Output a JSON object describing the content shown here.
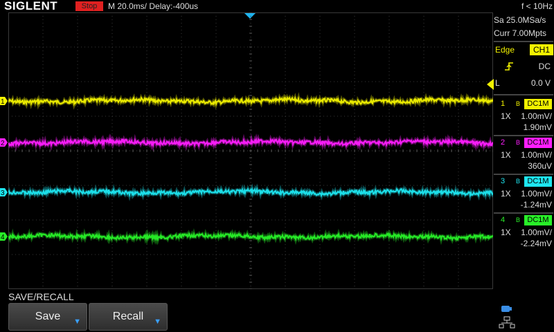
{
  "header": {
    "brand": "SIGLENT",
    "run_state": "Stop",
    "timebase": "M 20.0ms/ Delay:-400us",
    "frequency": "f < 10Hz"
  },
  "acquisition": {
    "sample_rate": "Sa 25.0MSa/s",
    "memory": "Curr 7.00Mpts"
  },
  "trigger": {
    "type_label": "Edge",
    "source": "CH1",
    "coupling": "DC",
    "level_label": "L",
    "level": "0.0 V"
  },
  "channels": [
    {
      "num": "1",
      "b": "B",
      "coupling": "DC1M",
      "probe": "1X",
      "scale": "1.00mV/",
      "offset": "1.90mV",
      "color": "#f2f200",
      "marker": "1",
      "level": 0.32
    },
    {
      "num": "2",
      "b": "B",
      "coupling": "DC1M",
      "probe": "1X",
      "scale": "1.00mV/",
      "offset": "360uV",
      "color": "#ff1eff",
      "marker": "2",
      "level": 0.47
    },
    {
      "num": "3",
      "b": "B",
      "coupling": "DC1M",
      "probe": "1X",
      "scale": "1.00mV/",
      "offset": "-1.24mV",
      "color": "#1ee6f0",
      "marker": "3",
      "level": 0.65
    },
    {
      "num": "4",
      "b": "B",
      "coupling": "DC1M",
      "probe": "1X",
      "scale": "1.00mV/",
      "offset": "-2.24mV",
      "color": "#28f028",
      "marker": "4",
      "level": 0.81
    }
  ],
  "menu": {
    "title": "SAVE/RECALL",
    "softkeys": [
      {
        "label": "Save",
        "arrow": "▼"
      },
      {
        "label": "Recall",
        "arrow": "▼"
      }
    ]
  },
  "colors": {
    "accent_trigger": "#f2f200",
    "stop_badge": "#e02020",
    "grid": "#3a3a3a"
  }
}
